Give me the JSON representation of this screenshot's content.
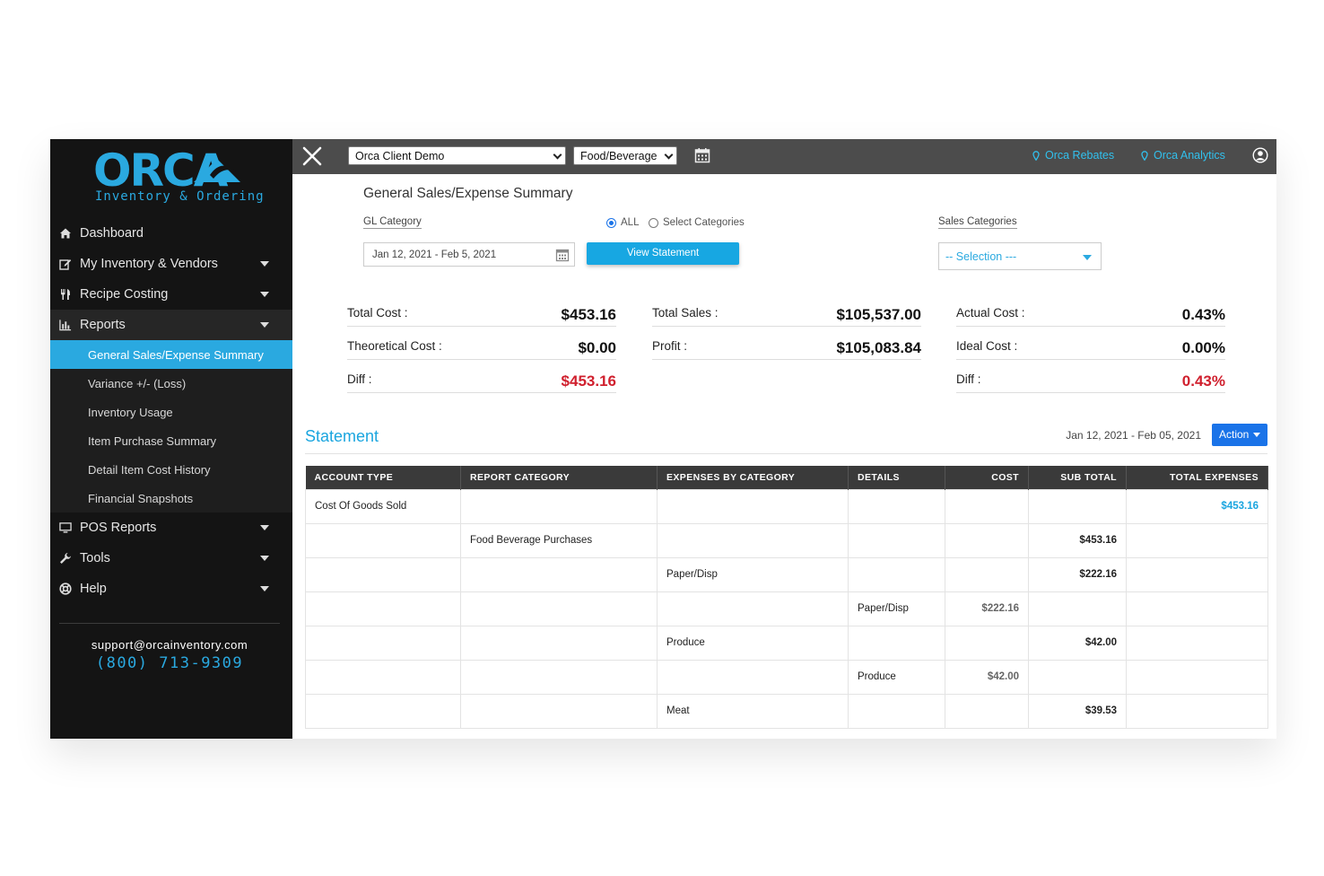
{
  "app": {
    "logo_word": "ORCA",
    "logo_sub": "Inventory & Ordering",
    "brand_color": "#2aa9e0"
  },
  "sidebar": {
    "items": [
      {
        "label": "Dashboard",
        "icon": "home-icon"
      },
      {
        "label": "My Inventory & Vendors",
        "icon": "edit-icon"
      },
      {
        "label": "Recipe Costing",
        "icon": "utensils-icon"
      },
      {
        "label": "Reports",
        "icon": "bar-chart-icon"
      },
      {
        "label": "POS Reports",
        "icon": "monitor-icon"
      },
      {
        "label": "Tools",
        "icon": "wrench-icon"
      },
      {
        "label": "Help",
        "icon": "lifebuoy-icon"
      }
    ],
    "reports_sub": [
      "General Sales/Expense Summary",
      "Variance +/- (Loss)",
      "Inventory Usage",
      "Item Purchase Summary",
      "Detail Item Cost History",
      "Financial Snapshots"
    ],
    "support_email": "support@orcainventory.com",
    "support_phone": "(800) 713-9309"
  },
  "topbar": {
    "client_select": "Orca Client Demo",
    "category_select": "Food/Beverage",
    "rebates_link": "Orca Rebates",
    "analytics_link": "Orca Analytics"
  },
  "main": {
    "title": "General Sales/Expense Summary",
    "gl_category_label": "GL Category",
    "radio_all": "ALL",
    "radio_select": "Select Categories",
    "sales_categories_label": "Sales Categories",
    "date_range": "Jan 12, 2021 - Feb 5, 2021",
    "view_button": "View Statement",
    "sales_select": "-- Selection ---",
    "metrics": {
      "total_cost_label": "Total Cost :",
      "total_cost": "$453.16",
      "theoretical_cost_label": "Theoretical Cost :",
      "theoretical_cost": "$0.00",
      "diff_label": "Diff :",
      "diff": "$453.16",
      "total_sales_label": "Total Sales :",
      "total_sales": "$105,537.00",
      "profit_label": "Profit :",
      "profit": "$105,083.84",
      "actual_cost_label": "Actual Cost :",
      "actual_cost": "0.43%",
      "ideal_cost_label": "Ideal Cost :",
      "ideal_cost": "0.00%",
      "diff2_label": "Diff :",
      "diff2": "0.43%"
    },
    "statement_title": "Statement",
    "statement_range": "Jan 12, 2021 - Feb 05, 2021",
    "action_button": "Action"
  },
  "table": {
    "headers": [
      "ACCOUNT TYPE",
      "REPORT CATEGORY",
      "EXPENSES BY CATEGORY",
      "DETAILS",
      "COST",
      "SUB TOTAL",
      "TOTAL EXPENSES"
    ],
    "rows": [
      [
        "Cost Of Goods Sold",
        "",
        "",
        "",
        "",
        "",
        "$453.16"
      ],
      [
        "",
        "Food Beverage Purchases",
        "",
        "",
        "",
        "$453.16",
        ""
      ],
      [
        "",
        "",
        "Paper/Disp",
        "",
        "",
        "$222.16",
        ""
      ],
      [
        "",
        "",
        "",
        "Paper/Disp",
        "$222.16",
        "",
        ""
      ],
      [
        "",
        "",
        "Produce",
        "",
        "",
        "$42.00",
        ""
      ],
      [
        "",
        "",
        "",
        "Produce",
        "$42.00",
        "",
        ""
      ],
      [
        "",
        "",
        "Meat",
        "",
        "",
        "$39.53",
        ""
      ]
    ]
  }
}
